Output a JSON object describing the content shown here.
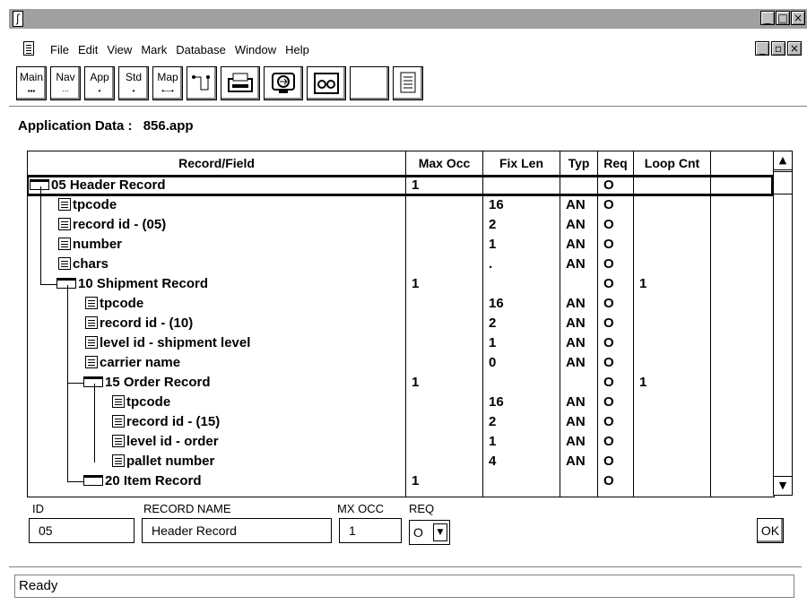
{
  "window": {
    "title_icon": "app-icon"
  },
  "menu": [
    "File",
    "Edit",
    "View",
    "Mark",
    "Database",
    "Window",
    "Help"
  ],
  "toolbar": [
    {
      "label": "Main",
      "dots": "▪▪▪"
    },
    {
      "label": "Nav",
      "dots": "⋯"
    },
    {
      "label": "App",
      "dots": "•"
    },
    {
      "label": "Std",
      "dots": "•"
    },
    {
      "label": "Map",
      "dots": "•—•"
    }
  ],
  "header": {
    "app_data_label": "Application Data :",
    "app_file": "856.app"
  },
  "grid": {
    "columns": [
      "Record/Field",
      "Max Occ",
      "Fix Len",
      "Typ",
      "Req",
      "Loop Cnt"
    ],
    "rows": [
      {
        "kind": "rec",
        "indent": 0,
        "name": "05  Header Record",
        "max": "1",
        "fix": "",
        "typ": "",
        "req": "O",
        "loop": ""
      },
      {
        "kind": "fld",
        "indent": 1,
        "name": "tpcode",
        "max": "",
        "fix": "16",
        "typ": "AN",
        "req": "O",
        "loop": ""
      },
      {
        "kind": "fld",
        "indent": 1,
        "name": "record id - (05)",
        "max": "",
        "fix": "2",
        "typ": "AN",
        "req": "O",
        "loop": ""
      },
      {
        "kind": "fld",
        "indent": 1,
        "name": "number",
        "max": "",
        "fix": "1",
        "typ": "AN",
        "req": "O",
        "loop": ""
      },
      {
        "kind": "fld",
        "indent": 1,
        "name": "chars",
        "max": "",
        "fix": ".",
        "typ": "AN",
        "req": "O",
        "loop": ""
      },
      {
        "kind": "rec",
        "indent": 1,
        "name": "10  Shipment Record",
        "max": "1",
        "fix": "",
        "typ": "",
        "req": "O",
        "loop": "1"
      },
      {
        "kind": "fld",
        "indent": 2,
        "name": "tpcode",
        "max": "",
        "fix": "16",
        "typ": "AN",
        "req": "O",
        "loop": ""
      },
      {
        "kind": "fld",
        "indent": 2,
        "name": "record id - (10)",
        "max": "",
        "fix": "2",
        "typ": "AN",
        "req": "O",
        "loop": ""
      },
      {
        "kind": "fld",
        "indent": 2,
        "name": "level id - shipment level",
        "max": "",
        "fix": "1",
        "typ": "AN",
        "req": "O",
        "loop": ""
      },
      {
        "kind": "fld",
        "indent": 2,
        "name": "carrier name",
        "max": "",
        "fix": "0",
        "typ": "AN",
        "req": "O",
        "loop": ""
      },
      {
        "kind": "rec",
        "indent": 2,
        "name": "15  Order Record",
        "max": "1",
        "fix": "",
        "typ": "",
        "req": "O",
        "loop": "1"
      },
      {
        "kind": "fld",
        "indent": 3,
        "name": "tpcode",
        "max": "",
        "fix": "16",
        "typ": "AN",
        "req": "O",
        "loop": ""
      },
      {
        "kind": "fld",
        "indent": 3,
        "name": "record id - (15)",
        "max": "",
        "fix": "2",
        "typ": "AN",
        "req": "O",
        "loop": ""
      },
      {
        "kind": "fld",
        "indent": 3,
        "name": "level id - order",
        "max": "",
        "fix": "1",
        "typ": "AN",
        "req": "O",
        "loop": ""
      },
      {
        "kind": "fld",
        "indent": 3,
        "name": "pallet number",
        "max": "",
        "fix": "4",
        "typ": "AN",
        "req": "O",
        "loop": ""
      },
      {
        "kind": "rec",
        "indent": 2,
        "name": "20  Item Record",
        "max": "1",
        "fix": "",
        "typ": "",
        "req": "O",
        "loop": ""
      }
    ]
  },
  "form": {
    "id_label": "ID",
    "id_value": "05",
    "name_label": "RECORD NAME",
    "name_value": "Header Record",
    "mxocc_label": "MX OCC",
    "mxocc_value": "1",
    "req_label": "REQ",
    "req_value": "O",
    "ok_label": "OK"
  },
  "status": "Ready"
}
